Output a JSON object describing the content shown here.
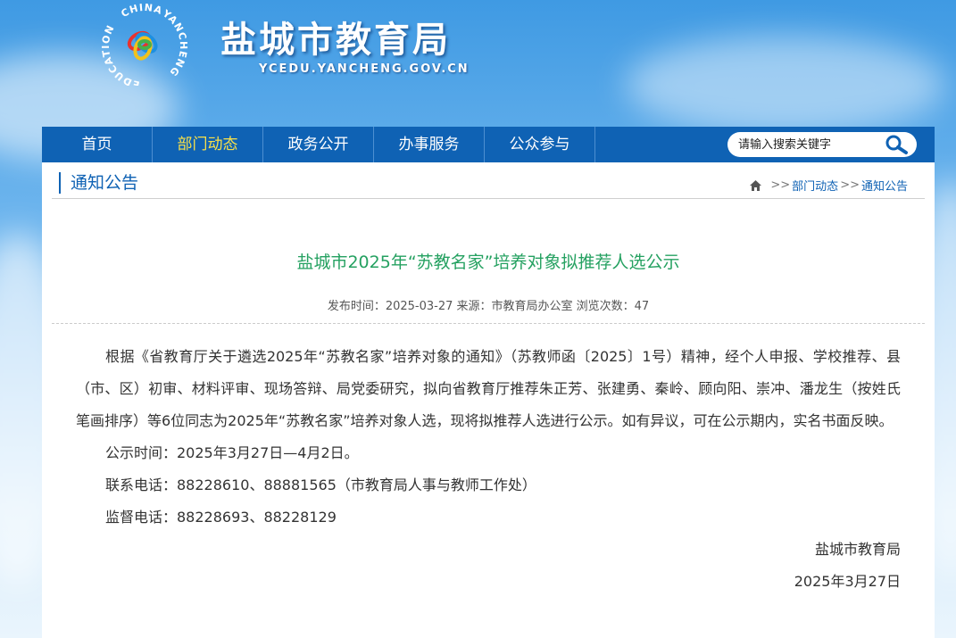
{
  "header": {
    "logo_ring_text_top": "CHINA",
    "logo_ring_text_left": "EDUCATION",
    "logo_ring_text_right": "YANCHENG",
    "site_title": "盐城市教育局",
    "site_url": "YCEDU.YANCHENG.GOV.CN"
  },
  "nav": {
    "items": [
      {
        "label": "首页"
      },
      {
        "label": "部门动态",
        "active": true
      },
      {
        "label": "政务公开"
      },
      {
        "label": "办事服务"
      },
      {
        "label": "公众参与"
      }
    ],
    "search_placeholder": "请输入搜索关键字",
    "search_icon": "magnifier-icon"
  },
  "section": {
    "title": "通知公告",
    "breadcrumb": {
      "home_icon": "home-icon",
      "sep1": ">>",
      "item1": "部门动态",
      "sep2": ">>",
      "item2": "通知公告"
    }
  },
  "article": {
    "title": "盐城市2025年“苏教名家”培养对象拟推荐人选公示",
    "meta": "发布时间：2025-03-27 来源：市教育局办公室 浏览次数：47",
    "paragraphs": [
      "根据《省教育厅关于遴选2025年“苏教名家”培养对象的通知》（苏教师函〔2025〕1号）精神，经个人申报、学校推荐、县（市、区）初审、材料评审、现场答辩、局党委研究，拟向省教育厅推荐朱正芳、张建勇、秦岭、顾向阳、崇冲、潘龙生（按姓氏笔画排序）等6位同志为2025年“苏教名家”培养对象人选，现将拟推荐人选进行公示。如有异议，可在公示期内，实名书面反映。",
      "公示时间：2025年3月27日—4月2日。",
      "联系电话：88228610、88881565（市教育局人事与教师工作处）",
      "监督电话：88228693、88228129"
    ],
    "signature": "盐城市教育局",
    "date": "2025年3月27日"
  },
  "colors": {
    "nav_bg": "#0f62b4",
    "nav_active": "#f8e04a",
    "title_green": "#25a161",
    "link_blue": "#0f62b4"
  }
}
